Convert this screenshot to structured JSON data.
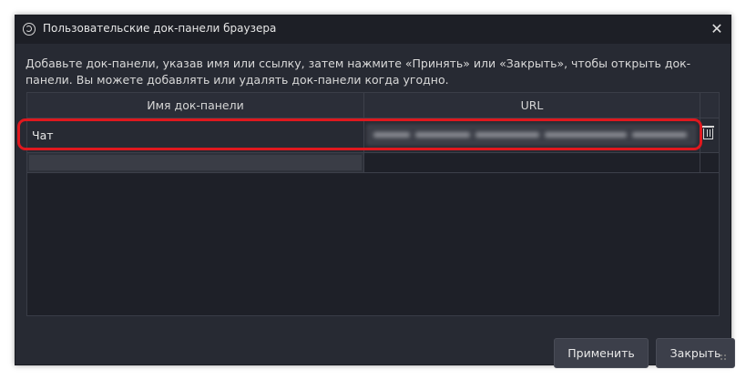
{
  "window": {
    "title": "Пользовательские док-панели браузера",
    "close_glyph": "✕"
  },
  "description": "Добавьте док-панели, указав имя или ссылку, затем нажмите «Принять» или «Закрыть», чтобы открыть док-панели. Вы можете добавлять или удалять док-панели когда угодно.",
  "table": {
    "columns": [
      "Имя док-панели",
      "URL"
    ],
    "rows": [
      {
        "name": "Чат",
        "url": "",
        "delete_icon": "trash-icon"
      }
    ]
  },
  "buttons": {
    "apply_label": "Применить",
    "close_label": "Закрыть"
  },
  "colors": {
    "highlight": "#e0181e",
    "window_bg": "#272a33"
  }
}
